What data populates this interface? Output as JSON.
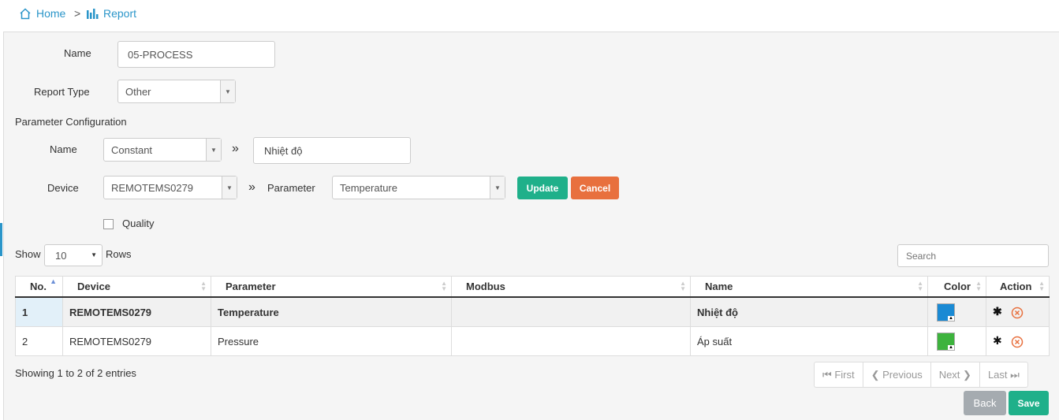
{
  "breadcrumb": {
    "home": "Home",
    "separator": ">",
    "report": "Report"
  },
  "form": {
    "name_label": "Name",
    "name_value": "05-PROCESS",
    "report_type_label": "Report Type",
    "report_type_value": "Other",
    "param_config_title": "Parameter Configuration",
    "param_name_label": "Name",
    "param_name_type": "Constant",
    "param_name_value": "Nhiệt độ",
    "device_label": "Device",
    "device_value": "REMOTEMS0279",
    "parameter_label": "Parameter",
    "parameter_value": "Temperature",
    "update_button": "Update",
    "cancel_button": "Cancel",
    "quality_label": "Quality",
    "arrow_glyph": "»"
  },
  "table_controls": {
    "show_label": "Show",
    "rows_value": "10",
    "rows_label": "Rows",
    "search_placeholder": "Search"
  },
  "table": {
    "headers": [
      "No.",
      "Device",
      "Parameter",
      "Modbus",
      "Name",
      "Color",
      "Action"
    ],
    "rows": [
      {
        "no": "1",
        "device": "REMOTEMS0279",
        "parameter": "Temperature",
        "modbus": "",
        "name": "Nhiệt độ",
        "color": "#1a8ad4"
      },
      {
        "no": "2",
        "device": "REMOTEMS0279",
        "parameter": "Pressure",
        "modbus": "",
        "name": "Áp suất",
        "color": "#3db33d"
      }
    ]
  },
  "footer": {
    "showing": "Showing 1 to 2 of 2 entries",
    "first": "First",
    "previous": "Previous",
    "next": "Next",
    "last": "Last",
    "back_button": "Back",
    "save_button": "Save"
  },
  "colors": {
    "accent": "#2a95c9",
    "update": "#1fb08a",
    "cancel": "#e8703e",
    "back": "#a5abb0",
    "save": "#1fb08a",
    "delete": "#e8703e"
  }
}
